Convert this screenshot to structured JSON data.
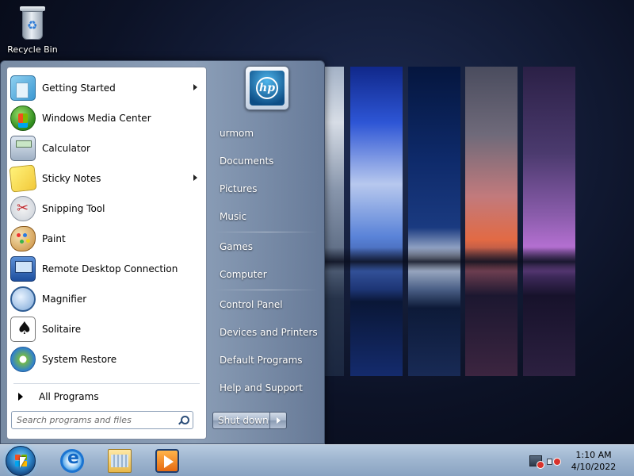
{
  "desktop": {
    "icons": [
      {
        "label": "Recycle Bin",
        "icon": "recycle-bin-icon"
      }
    ]
  },
  "start_menu": {
    "programs": [
      {
        "label": "Getting Started",
        "icon": "getting-started-icon",
        "has_submenu": true
      },
      {
        "label": "Windows Media Center",
        "icon": "windows-media-center-icon",
        "has_submenu": false
      },
      {
        "label": "Calculator",
        "icon": "calculator-icon",
        "has_submenu": false
      },
      {
        "label": "Sticky Notes",
        "icon": "sticky-notes-icon",
        "has_submenu": true
      },
      {
        "label": "Snipping Tool",
        "icon": "snipping-tool-icon",
        "has_submenu": false
      },
      {
        "label": "Paint",
        "icon": "paint-icon",
        "has_submenu": false
      },
      {
        "label": "Remote Desktop Connection",
        "icon": "remote-desktop-icon",
        "has_submenu": false
      },
      {
        "label": "Magnifier",
        "icon": "magnifier-icon",
        "has_submenu": false
      },
      {
        "label": "Solitaire",
        "icon": "solitaire-icon",
        "has_submenu": false
      },
      {
        "label": "System Restore",
        "icon": "system-restore-icon",
        "has_submenu": false
      }
    ],
    "all_programs_label": "All Programs",
    "search": {
      "placeholder": "Search programs and files",
      "value": ""
    },
    "user_tile": {
      "logo_text": "hp"
    },
    "right_items": [
      {
        "label": "urmom"
      },
      {
        "label": "Documents"
      },
      {
        "label": "Pictures"
      },
      {
        "label": "Music"
      },
      {
        "label": "Games"
      },
      {
        "label": "Computer"
      },
      {
        "label": "Control Panel"
      },
      {
        "label": "Devices and Printers"
      },
      {
        "label": "Default Programs"
      },
      {
        "label": "Help and Support"
      }
    ],
    "shutdown_label": "Shut down"
  },
  "taskbar": {
    "pinned": [
      {
        "name": "Internet Explorer",
        "icon": "internet-explorer-icon"
      },
      {
        "name": "Windows Explorer",
        "icon": "windows-explorer-icon"
      },
      {
        "name": "Windows Media Player",
        "icon": "media-player-icon"
      }
    ],
    "tray": {
      "network_status": "disconnected",
      "volume_status": "muted"
    },
    "clock": {
      "time": "1:10 AM",
      "date": "4/10/2022"
    }
  }
}
